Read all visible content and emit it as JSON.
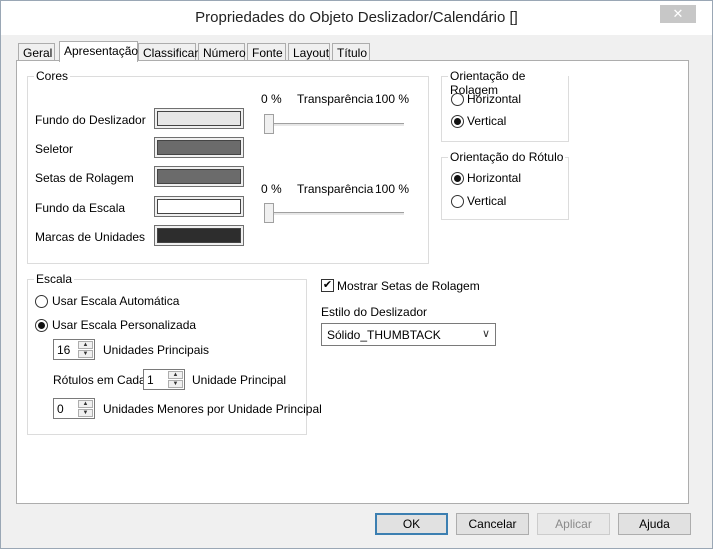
{
  "window": {
    "title": "Propriedades do Objeto Deslizador/Calendário []",
    "close_label": "✕"
  },
  "tabs": [
    "Geral",
    "Apresentação",
    "Classificar",
    "Número",
    "Fonte",
    "Layout",
    "Título"
  ],
  "cores": {
    "legend": "Cores",
    "labels": [
      "Fundo do Deslizador",
      "Seletor",
      "Setas de Rolagem",
      "Fundo da Escala",
      "Marcas de Unidades"
    ],
    "swatch_colors": [
      "#e6e6e6",
      "#6b6b6b",
      "#6b6b6b",
      "#ffffff",
      "#2d2d2d"
    ],
    "transparency": {
      "min_label": "0 %",
      "title": "Transparência",
      "max_label": "100 %",
      "values": [
        0,
        0
      ]
    }
  },
  "orientacao_rolagem": {
    "legend": "Orientação de Rolagem",
    "options": [
      "Horizontal",
      "Vertical"
    ],
    "selected": "Vertical"
  },
  "orientacao_rotulo": {
    "legend": "Orientação do Rótulo",
    "options": [
      "Horizontal",
      "Vertical"
    ],
    "selected": "Horizontal"
  },
  "escala": {
    "legend": "Escala",
    "auto_label": "Usar Escala Automática",
    "custom_label": "Usar Escala Personalizada",
    "selected": "custom",
    "principais_value": "16",
    "principais_label": "Unidades Principais",
    "rotulos_prefix": "Rótulos em Cada",
    "rotulos_value": "1",
    "rotulos_suffix": "Unidade Principal",
    "menores_value": "0",
    "menores_label": "Unidades Menores por Unidade Principal"
  },
  "mostrar_setas": {
    "label": "Mostrar Setas de Rolagem",
    "checked": true
  },
  "estilo": {
    "label": "Estilo do Deslizador",
    "value": "Sólido_THUMBTACK"
  },
  "buttons": {
    "ok": "OK",
    "cancel": "Cancelar",
    "apply": "Aplicar",
    "help": "Ajuda"
  }
}
